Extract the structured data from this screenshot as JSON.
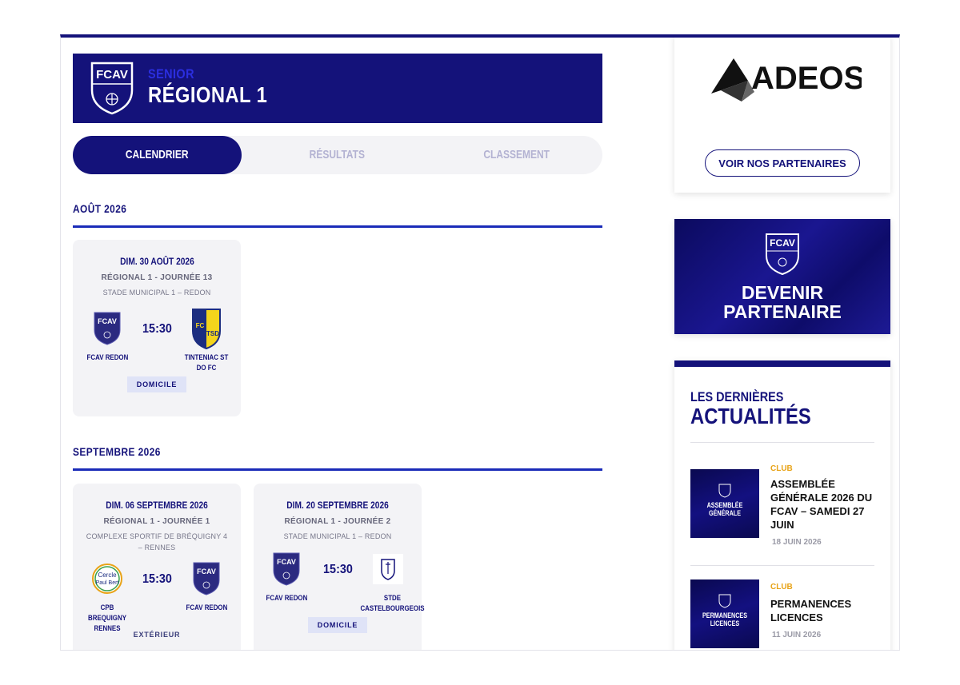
{
  "header": {
    "category": "SENIOR",
    "title": "RÉGIONAL 1",
    "crest_text": "FCAV"
  },
  "tabs": [
    {
      "label": "CALENDRIER",
      "active": true
    },
    {
      "label": "RÉSULTATS",
      "active": false
    },
    {
      "label": "CLASSEMENT",
      "active": false
    }
  ],
  "months": [
    {
      "label": "AOÛT 2026",
      "matches": [
        {
          "date": "DIM. 30 AOÛT 2026",
          "competition": "RÉGIONAL 1 - JOURNÉE 13",
          "venue": "STADE MUNICIPAL 1 – REDON",
          "home": "FCAV REDON",
          "away": "TINTENIAC ST DO FC",
          "time": "15:30",
          "location": "DOMICILE"
        }
      ]
    },
    {
      "label": "SEPTEMBRE 2026",
      "matches": [
        {
          "date": "DIM. 06 SEPTEMBRE 2026",
          "competition": "RÉGIONAL 1 - JOURNÉE 1",
          "venue": "COMPLEXE SPORTIF DE BRÉQUIGNY 4 – RENNES",
          "home": "CPB BREQUIGNY RENNES",
          "away": "FCAV REDON",
          "time": "15:30",
          "location": "EXTÉRIEUR"
        },
        {
          "date": "DIM. 20 SEPTEMBRE 2026",
          "competition": "RÉGIONAL 1 - JOURNÉE 2",
          "venue": "STADE MUNICIPAL 1 – REDON",
          "home": "FCAV REDON",
          "away": "STDE CASTELBOURGEOIS",
          "time": "15:30",
          "location": "DOMICILE"
        }
      ]
    }
  ],
  "sidebar": {
    "sponsor_name": "ADEOS",
    "partners_button": "VOIR NOS PARTENAIRES",
    "become_partner_line1": "DEVENIR",
    "become_partner_line2": "PARTENAIRE",
    "news_heading_small": "LES DERNIÈRES",
    "news_heading_large": "ACTUALITÉS",
    "news": [
      {
        "category": "CLUB",
        "title": "ASSEMBLÉE GÉNÉRALE 2026 DU FCAV – SAMEDI 27 JUIN",
        "date": "18 JUIN 2026",
        "thumb_text": "ASSEMBLÉE GÉNÉRALE"
      },
      {
        "category": "CLUB",
        "title": "PERMANENCES LICENCES",
        "date": "11 JUIN 2026",
        "thumb_text": "PERMANENCES LICENCES"
      }
    ]
  },
  "colors": {
    "navy": "#14127a",
    "accent_blue": "#1a2bb8",
    "category_gold": "#e8a317",
    "card_bg": "#f3f3f6"
  }
}
